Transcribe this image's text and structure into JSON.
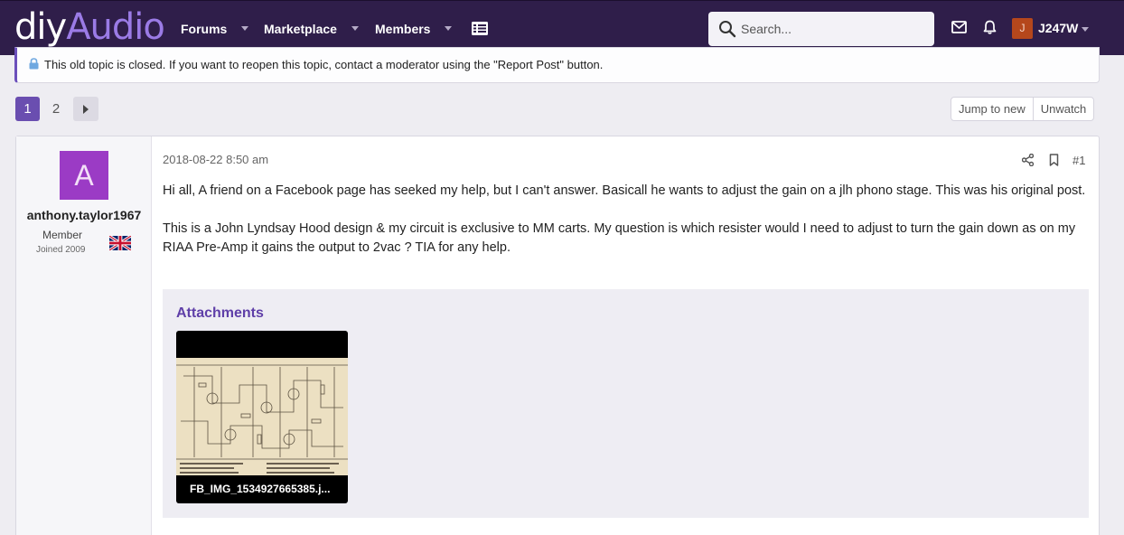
{
  "header": {
    "logo_diy": "diy",
    "logo_audio": "Audio",
    "nav": [
      {
        "label": "Forums"
      },
      {
        "label": "Marketplace"
      },
      {
        "label": "Members"
      }
    ],
    "search_placeholder": "Search...",
    "user_initial": "J",
    "username": "J247W",
    "colors": {
      "bar": "#2f1e4a",
      "accent": "#9b7be6"
    }
  },
  "notice": {
    "text": "This old topic is closed. If you want to reopen this topic, contact a moderator using the \"Report Post\" button."
  },
  "pagination": {
    "pages": [
      "1",
      "2"
    ],
    "current": "1"
  },
  "thread_actions": {
    "jump_to_new": "Jump to new",
    "unwatch": "Unwatch"
  },
  "post": {
    "avatar_letter": "A",
    "author": "anthony.taylor1967",
    "user_title": "Member",
    "joined": "Joined 2009",
    "flag": "uk-flag-icon",
    "date": "2018-08-22 8:50 am",
    "number": "#1",
    "paragraphs": [
      "Hi all, A friend on a Facebook page has seeked my help, but I can't answer. Basicall he wants to adjust the gain on a jlh phono stage. This was his original post.",
      "This is a John Lyndsay Hood design & my circuit is exclusive to MM carts. My question is which resister would I need to adjust to turn the gain down as on my RIAA Pre-Amp it gains the output to 2vac ? TIA for any help."
    ],
    "attachments_title": "Attachments",
    "attachment_name": "FB_IMG_1534927665385.j..."
  }
}
